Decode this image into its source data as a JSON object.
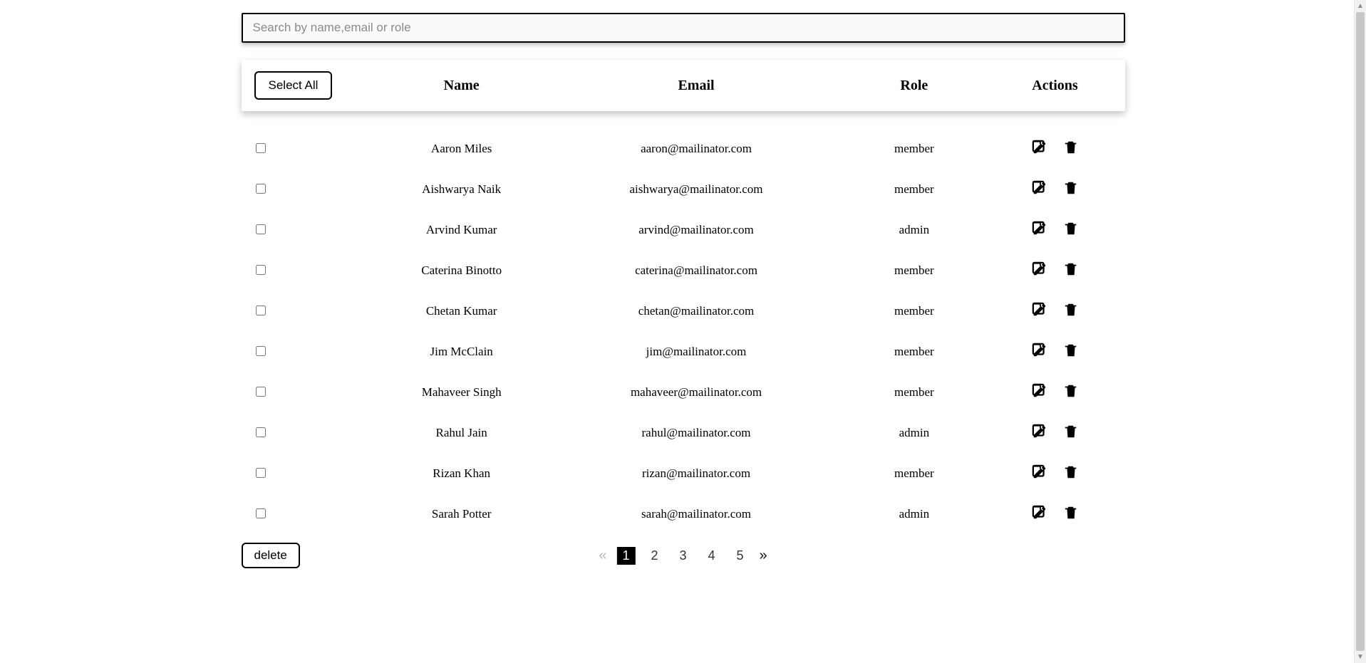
{
  "search": {
    "placeholder": "Search by name,email or role",
    "value": ""
  },
  "header": {
    "select_all": "Select All",
    "columns": {
      "name": "Name",
      "email": "Email",
      "role": "Role",
      "actions": "Actions"
    }
  },
  "rows": [
    {
      "name": "Aaron Miles",
      "email": "aaron@mailinator.com",
      "role": "member"
    },
    {
      "name": "Aishwarya Naik",
      "email": "aishwarya@mailinator.com",
      "role": "member"
    },
    {
      "name": "Arvind Kumar",
      "email": "arvind@mailinator.com",
      "role": "admin"
    },
    {
      "name": "Caterina Binotto",
      "email": "caterina@mailinator.com",
      "role": "member"
    },
    {
      "name": "Chetan Kumar",
      "email": "chetan@mailinator.com",
      "role": "member"
    },
    {
      "name": "Jim McClain",
      "email": "jim@mailinator.com",
      "role": "member"
    },
    {
      "name": "Mahaveer Singh",
      "email": "mahaveer@mailinator.com",
      "role": "member"
    },
    {
      "name": "Rahul Jain",
      "email": "rahul@mailinator.com",
      "role": "admin"
    },
    {
      "name": "Rizan Khan",
      "email": "rizan@mailinator.com",
      "role": "member"
    },
    {
      "name": "Sarah Potter",
      "email": "sarah@mailinator.com",
      "role": "admin"
    }
  ],
  "footer": {
    "delete": "delete"
  },
  "pagination": {
    "current": 1,
    "pages": [
      1,
      2,
      3,
      4,
      5
    ]
  },
  "icons": {
    "edit": "edit-icon",
    "trash": "trash-icon"
  }
}
